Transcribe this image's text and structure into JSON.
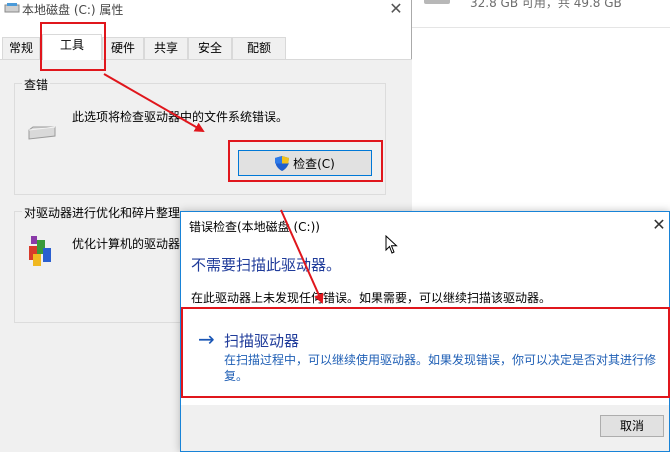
{
  "background": {
    "disk_info": "32.8 GB 可用，共 49.8 GB"
  },
  "properties": {
    "title": "本地磁盘 (C:) 属性",
    "tabs": [
      {
        "label": "常规"
      },
      {
        "label": "工具"
      },
      {
        "label": "硬件"
      },
      {
        "label": "共享"
      },
      {
        "label": "安全"
      },
      {
        "label": "配额"
      }
    ],
    "active_tab": "工具",
    "check_group": {
      "title": "查错",
      "description": "此选项将检查驱动器中的文件系统错误。",
      "button_label": "检查(C)"
    },
    "optimize_group": {
      "title": "对驱动器进行优化和碎片整理",
      "description": "优化计算机的驱动器"
    }
  },
  "dialog": {
    "title": "错误检查(本地磁盘 (C:))",
    "heading": "不需要扫描此驱动器。",
    "message": "在此驱动器上未发现任何错误。如果需要，可以继续扫描该驱动器。",
    "scan_option": {
      "arrow": "→",
      "label": "扫描驱动器",
      "description": "在扫描过程中，可以继续使用驱动器。如果发现错误，你可以决定是否对其进行修复。"
    },
    "cancel_label": "取消"
  },
  "colors": {
    "annotation_red": "#e0161c",
    "dialog_border": "#1883d7",
    "link_blue": "#1f3b9a"
  },
  "icons": {
    "title_drive": "drive-icon",
    "check_drive": "hard-drive-icon",
    "check_button": "uac-shield-icon",
    "optimize": "defrag-icon",
    "close": "close-icon",
    "cursor": "mouse-pointer-icon"
  }
}
